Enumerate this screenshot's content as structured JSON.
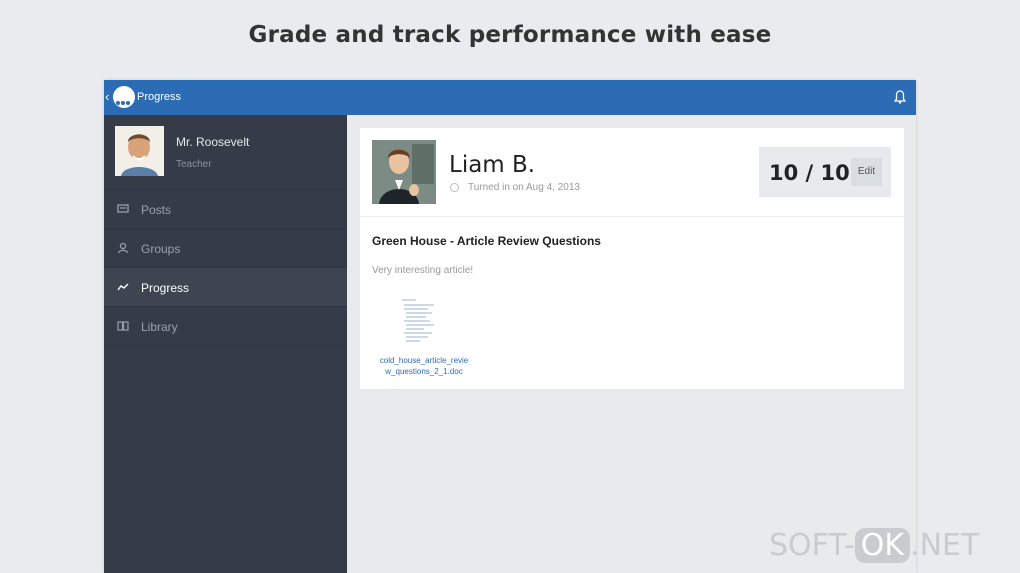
{
  "headline": "Grade and track performance with ease",
  "appbar": {
    "title": "Progress",
    "back_glyph": "‹",
    "icons": [
      "back-chevron-icon",
      "app-logo-icon",
      "bell-icon"
    ]
  },
  "colors": {
    "accent": "#2b6cb5",
    "sidebar_bg": "#363c47",
    "sidebar_active": "#3f4550",
    "page_bg": "#e9ebee"
  },
  "sidebar": {
    "profile": {
      "name": "Mr. Roosevelt",
      "role": "Teacher"
    },
    "items": [
      {
        "label": "Posts",
        "icon": "posts-icon"
      },
      {
        "label": "Groups",
        "icon": "groups-icon"
      },
      {
        "label": "Progress",
        "icon": "progress-icon",
        "active": true
      },
      {
        "label": "Library",
        "icon": "library-icon"
      }
    ]
  },
  "submission": {
    "student_name": "Liam  B.",
    "turned_in": "Turned in on Aug 4, 2013",
    "grade": "10 / 10",
    "edit_label": "Edit",
    "assignment_title": "Green House - Article Review Questions",
    "comment": "Very interesting article!",
    "attachment_line1": "cold_house_article_revie",
    "attachment_line2": "w_questions_2_1.doc"
  },
  "watermark": {
    "left": "SOFT-",
    "badge": "OK",
    "right": ".NET"
  }
}
